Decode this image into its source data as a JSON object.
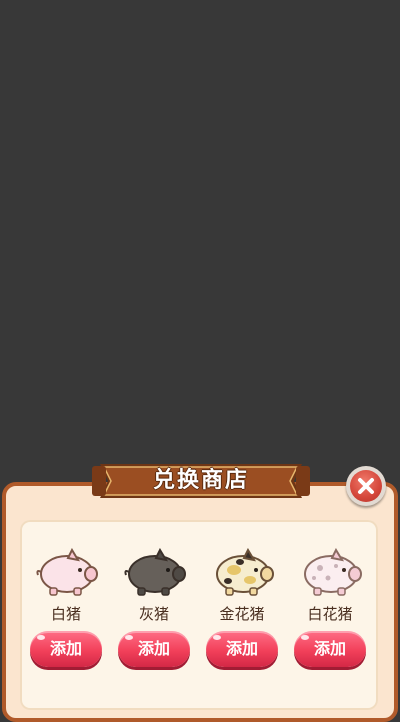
{
  "shop": {
    "title": "兑换商店",
    "items": [
      {
        "name": "白猪",
        "add_label": "添加",
        "pig_icon": "white-pig-icon"
      },
      {
        "name": "灰猪",
        "add_label": "添加",
        "pig_icon": "gray-pig-icon"
      },
      {
        "name": "金花猪",
        "add_label": "添加",
        "pig_icon": "golden-spotted-pig-icon"
      },
      {
        "name": "白花猪",
        "add_label": "添加",
        "pig_icon": "white-spotted-pig-icon"
      }
    ]
  },
  "colors": {
    "backdrop": "#383838",
    "panel": "#fbe5cf",
    "panel_border": "#b05a2a",
    "add_button": "#f2405a",
    "close_button": "#d4463a"
  }
}
